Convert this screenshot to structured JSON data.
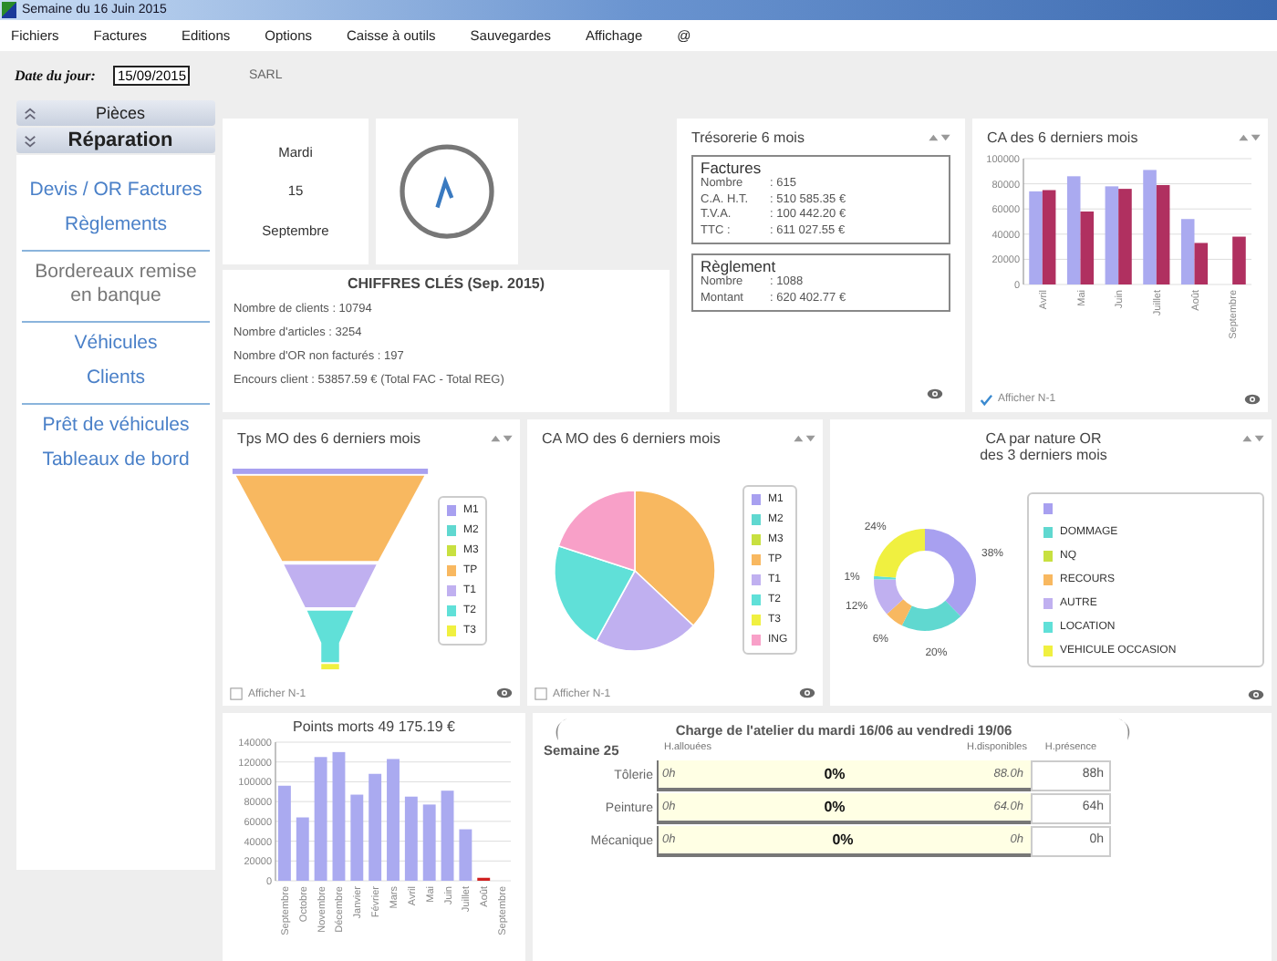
{
  "window": {
    "title": "Semaine du 16 Juin 2015"
  },
  "menu": [
    "Fichiers",
    "Factures",
    "Editions",
    "Options",
    "Caisse à outils",
    "Sauvegardes",
    "Affichage",
    "@"
  ],
  "date_bar": {
    "label": "Date du jour:",
    "value": "15/09/2015",
    "company": "SARL"
  },
  "sidebar": {
    "sections": [
      {
        "label": "Pièces",
        "expanded": false
      },
      {
        "label": "Réparation",
        "expanded": true
      }
    ],
    "groups": [
      {
        "items": [
          {
            "label": "Devis / OR Factures",
            "disabled": false
          },
          {
            "label": "Règlements",
            "disabled": false
          }
        ]
      },
      {
        "items": [
          {
            "label": "Bordereaux remise en banque",
            "disabled": true
          }
        ]
      },
      {
        "items": [
          {
            "label": "Véhicules",
            "disabled": false
          },
          {
            "label": "Clients",
            "disabled": false
          }
        ]
      },
      {
        "items": [
          {
            "label": "Prêt de véhicules",
            "disabled": false
          },
          {
            "label": "Tableaux de bord",
            "disabled": false
          }
        ]
      }
    ]
  },
  "date_card": {
    "weekday": "Mardi",
    "day": "15",
    "month": "Septembre"
  },
  "key_figures": {
    "title": "CHIFFRES CLÉS (Sep. 2015)",
    "lines": [
      "Nombre de clients : 10794",
      "Nombre d'articles : 3254",
      "Nombre d'OR non facturés : 197",
      "Encours client : 53857.59 € (Total FAC - Total REG)"
    ]
  },
  "treasury": {
    "title": "Trésorerie 6 mois",
    "boxes": [
      {
        "title": "Factures",
        "rows": [
          {
            "label": "Nombre",
            "value": ": 615"
          },
          {
            "label": "C.A. H.T.",
            "value": ": 510 585.35 €"
          },
          {
            "label": "T.V.A.",
            "value": ": 100 442.20 €"
          },
          {
            "label": "TTC :",
            "value": ": 611 027.55 €"
          }
        ]
      },
      {
        "title": "Règlement",
        "rows": [
          {
            "label": "Nombre",
            "value": ": 1088"
          },
          {
            "label": "Montant",
            "value": ": 620 402.77 €"
          }
        ]
      }
    ]
  },
  "revenue_chart": {
    "title": "CA des 6 derniers mois",
    "show_previous": {
      "label": "Afficher N-1",
      "checked": true
    },
    "chart_data": {
      "type": "bar",
      "grid": true,
      "categories": [
        "Avril",
        "Mai",
        "Juin",
        "Juillet",
        "Août",
        "Septembre"
      ],
      "ylim": [
        0,
        100000
      ],
      "yticks": [
        0,
        20000,
        40000,
        60000,
        80000,
        100000
      ],
      "series": [
        {
          "color": "#aaaaf0",
          "values": [
            74000,
            86000,
            78000,
            91000,
            52000,
            null
          ]
        },
        {
          "color": "#b03060",
          "values": [
            75000,
            58000,
            76000,
            79000,
            33000,
            38000
          ]
        }
      ]
    }
  },
  "labour_time_chart": {
    "title": "Tps MO des 6 derniers mois",
    "show_previous": {
      "label": "Afficher N-1",
      "checked": false
    },
    "legend": [
      {
        "label": "M1",
        "color": "#a8a0f0"
      },
      {
        "label": "M2",
        "color": "#60d8d0"
      },
      {
        "label": "M3",
        "color": "#c8e040"
      },
      {
        "label": "TP",
        "color": "#f8b860"
      },
      {
        "label": "T1",
        "color": "#c0b0f0"
      },
      {
        "label": "T2",
        "color": "#60e0d8"
      },
      {
        "label": "T3",
        "color": "#f0f040"
      }
    ]
  },
  "labour_revenue_chart": {
    "title": "CA MO des 6 derniers mois",
    "show_previous": {
      "label": "Afficher N-1",
      "checked": false
    },
    "legend": [
      {
        "label": "M1",
        "color": "#a8a0f0"
      },
      {
        "label": "M2",
        "color": "#60d8d0"
      },
      {
        "label": "M3",
        "color": "#c8e040"
      },
      {
        "label": "TP",
        "color": "#f8b860"
      },
      {
        "label": "T1",
        "color": "#c0b0f0"
      },
      {
        "label": "T2",
        "color": "#60e0d8"
      },
      {
        "label": "T3",
        "color": "#f0f040"
      },
      {
        "label": "ING",
        "color": "#f8a0c8"
      }
    ]
  },
  "nature_chart": {
    "title_lines": [
      "CA par nature OR",
      "des 3 derniers mois"
    ],
    "legend": [
      {
        "color": "#a8a0f0"
      },
      {
        "label": "DOMMAGE",
        "color": "#60d8d0"
      },
      {
        "label": "NQ",
        "color": "#c8e040"
      },
      {
        "label": "RECOURS",
        "color": "#f8b860"
      },
      {
        "label": "AUTRE",
        "color": "#c0b0f0"
      },
      {
        "label": "LOCATION",
        "color": "#60e0d8"
      },
      {
        "label": "VEHICULE OCCASION",
        "color": "#f0f040"
      }
    ],
    "chart_data": {
      "type": "donut",
      "values": [
        38,
        20,
        null,
        6,
        12,
        1,
        24
      ],
      "value_labels": [
        "38%",
        "20%",
        null,
        "6%",
        "12%",
        "1%",
        "24%"
      ]
    }
  },
  "breakeven_chart": {
    "title": "Points morts 49 175.19 €",
    "chart_data": {
      "type": "bar",
      "grid": true,
      "stacked": true,
      "categories": [
        "Septembre",
        "Octobre",
        "Novembre",
        "Décembre",
        "Janvier",
        "Février",
        "Mars",
        "Avril",
        "Mai",
        "Juin",
        "Juillet",
        "Août",
        "Septembre"
      ],
      "ylim": [
        0,
        140000
      ],
      "yticks": [
        0,
        20000,
        40000,
        60000,
        80000,
        100000,
        120000,
        140000
      ],
      "series": [
        {
          "color": "#aaaaf0",
          "values": [
            96000,
            64000,
            125000,
            130000,
            87000,
            108000,
            123000,
            85000,
            77000,
            91000,
            52000,
            null,
            null
          ]
        },
        {
          "color": "#d02020",
          "values": [
            null,
            null,
            null,
            null,
            null,
            null,
            null,
            null,
            null,
            null,
            null,
            3000,
            null
          ]
        }
      ]
    }
  },
  "workshop_load": {
    "title": "Charge de l'atelier du mardi 16/06 au vendredi 19/06",
    "week": "Semaine 25",
    "columns": [
      "H.allouées",
      "H.disponibles",
      "H.présence"
    ],
    "rows": [
      {
        "name": "Tôlerie",
        "allocated": "0h",
        "percent": "0%",
        "level": 0,
        "available": "88.0h",
        "presence": "88h"
      },
      {
        "name": "Peinture",
        "allocated": "0h",
        "percent": "0%",
        "level": 0,
        "available": "64.0h",
        "presence": "64h"
      },
      {
        "name": "Mécanique",
        "allocated": "0h",
        "percent": "0%",
        "level": 0,
        "available": "0h",
        "presence": "0h"
      }
    ]
  }
}
